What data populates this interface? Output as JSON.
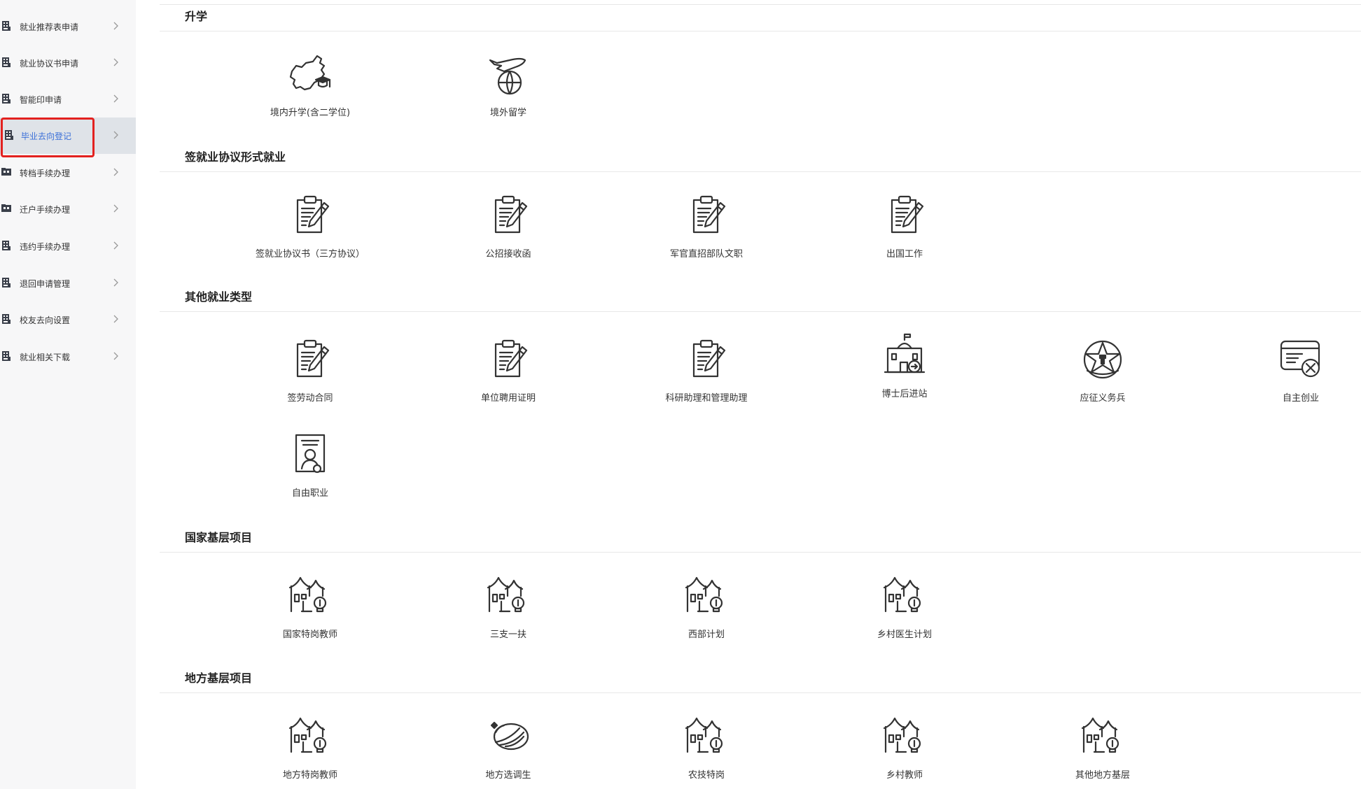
{
  "sidebar": {
    "items": [
      {
        "label": "就业推荐表申请",
        "icon": "building-icon"
      },
      {
        "label": "就业协议书申请",
        "icon": "building-icon"
      },
      {
        "label": "智能印申请",
        "icon": "stamp-building-icon"
      },
      {
        "label": "毕业去向登记",
        "icon": "building-icon",
        "active": true
      },
      {
        "label": "转档手续办理",
        "icon": "folder-icon"
      },
      {
        "label": "迁户手续办理",
        "icon": "folder-icon"
      },
      {
        "label": "违约手续办理",
        "icon": "building-icon"
      },
      {
        "label": "退回申请管理",
        "icon": "building-icon"
      },
      {
        "label": "校友去向设置",
        "icon": "building-icon"
      },
      {
        "label": "就业相关下载",
        "icon": "building-icon"
      }
    ],
    "highlight_color": "#e3211f",
    "active_color": "#3a6fd8"
  },
  "sections": {
    "shengxue": {
      "title": "升学",
      "items": [
        {
          "label": "境内升学(含二学位)",
          "icon": "china-map-graduation-icon"
        },
        {
          "label": "境外留学",
          "icon": "airplane-globe-icon"
        }
      ]
    },
    "agreement": {
      "title": "签就业协议形式就业",
      "items": [
        {
          "label": "签就业协议书（三方协议）",
          "icon": "clipboard-pen-icon"
        },
        {
          "label": "公招接收函",
          "icon": "clipboard-pen-icon"
        },
        {
          "label": "军官直招部队文职",
          "icon": "clipboard-pen-icon"
        },
        {
          "label": "出国工作",
          "icon": "clipboard-pen-icon"
        }
      ]
    },
    "other": {
      "title": "其他就业类型",
      "items": [
        {
          "label": "签劳动合同",
          "icon": "clipboard-pen-icon"
        },
        {
          "label": "单位聘用证明",
          "icon": "clipboard-pen-icon"
        },
        {
          "label": "科研助理和管理助理",
          "icon": "clipboard-pen-icon"
        },
        {
          "label": "博士后进站",
          "icon": "institute-building-icon"
        },
        {
          "label": "应征义务兵",
          "icon": "army-star-icon"
        },
        {
          "label": "自主创业",
          "icon": "card-tools-icon"
        },
        {
          "label": "自由职业",
          "icon": "document-person-icon"
        }
      ]
    },
    "national": {
      "title": "国家基层项目",
      "items": [
        {
          "label": "国家特岗教师",
          "icon": "village-bulb-icon"
        },
        {
          "label": "三支一扶",
          "icon": "village-bulb-icon"
        },
        {
          "label": "西部计划",
          "icon": "village-bulb-icon"
        },
        {
          "label": "乡村医生计划",
          "icon": "village-bulb-icon"
        }
      ]
    },
    "local": {
      "title": "地方基层项目",
      "items": [
        {
          "label": "地方特岗教师",
          "icon": "village-bulb-icon"
        },
        {
          "label": "地方选调生",
          "icon": "emblem-swoosh-icon"
        },
        {
          "label": "农技特岗",
          "icon": "village-bulb-icon"
        },
        {
          "label": "乡村教师",
          "icon": "village-bulb-icon"
        },
        {
          "label": "其他地方基层",
          "icon": "village-bulb-icon"
        }
      ]
    }
  }
}
